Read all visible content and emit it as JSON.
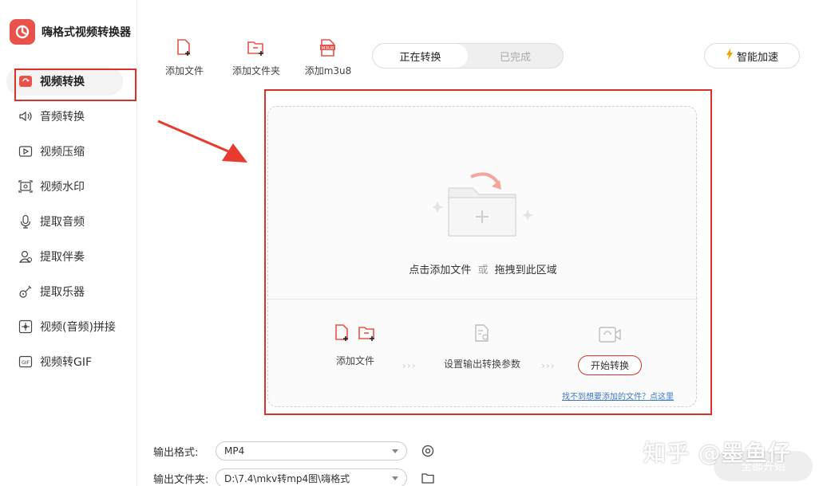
{
  "app": {
    "title": "嗨格式视频转换器"
  },
  "sidebar": {
    "items": [
      {
        "label": "视频转换",
        "icon": "video-convert-icon",
        "active": true
      },
      {
        "label": "音频转换",
        "icon": "speaker-icon",
        "active": false
      },
      {
        "label": "视频压缩",
        "icon": "video-compress-icon",
        "active": false
      },
      {
        "label": "视频水印",
        "icon": "watermark-icon",
        "active": false
      },
      {
        "label": "提取音频",
        "icon": "microphone-icon",
        "active": false
      },
      {
        "label": "提取伴奏",
        "icon": "accompaniment-icon",
        "active": false
      },
      {
        "label": "提取乐器",
        "icon": "guitar-icon",
        "active": false
      },
      {
        "label": "视频(音频)拼接",
        "icon": "merge-icon",
        "active": false
      },
      {
        "label": "视频转GIF",
        "icon": "gif-icon",
        "active": false
      }
    ]
  },
  "toolbar": {
    "add_file": "添加文件",
    "add_folder": "添加文件夹",
    "add_m3u8": "添加m3u8",
    "m3u8_badge": "M3U8"
  },
  "tabs": {
    "converting": "正在转换",
    "done": "已完成"
  },
  "accelerate": {
    "label": "智能加速"
  },
  "dropzone": {
    "hint_click": "点击添加文件",
    "hint_or": "或",
    "hint_drag": "拖拽到此区域",
    "step1": "添加文件",
    "step2": "设置输出转换参数",
    "step3_button": "开始转换",
    "help_link": "找不到想要添加的文件？点这里"
  },
  "output": {
    "format_label": "输出格式:",
    "format_value": "MP4",
    "folder_label": "输出文件夹:",
    "folder_value": "D:\\7.4\\mkv转mp4图\\嗨格式"
  },
  "watermark": {
    "text": "知乎 @墨鱼仔"
  },
  "bottom": {
    "start_all": "全部开始"
  },
  "colors": {
    "accent": "#e8524a",
    "highlight": "#d8322a",
    "link": "#3d78c9"
  }
}
